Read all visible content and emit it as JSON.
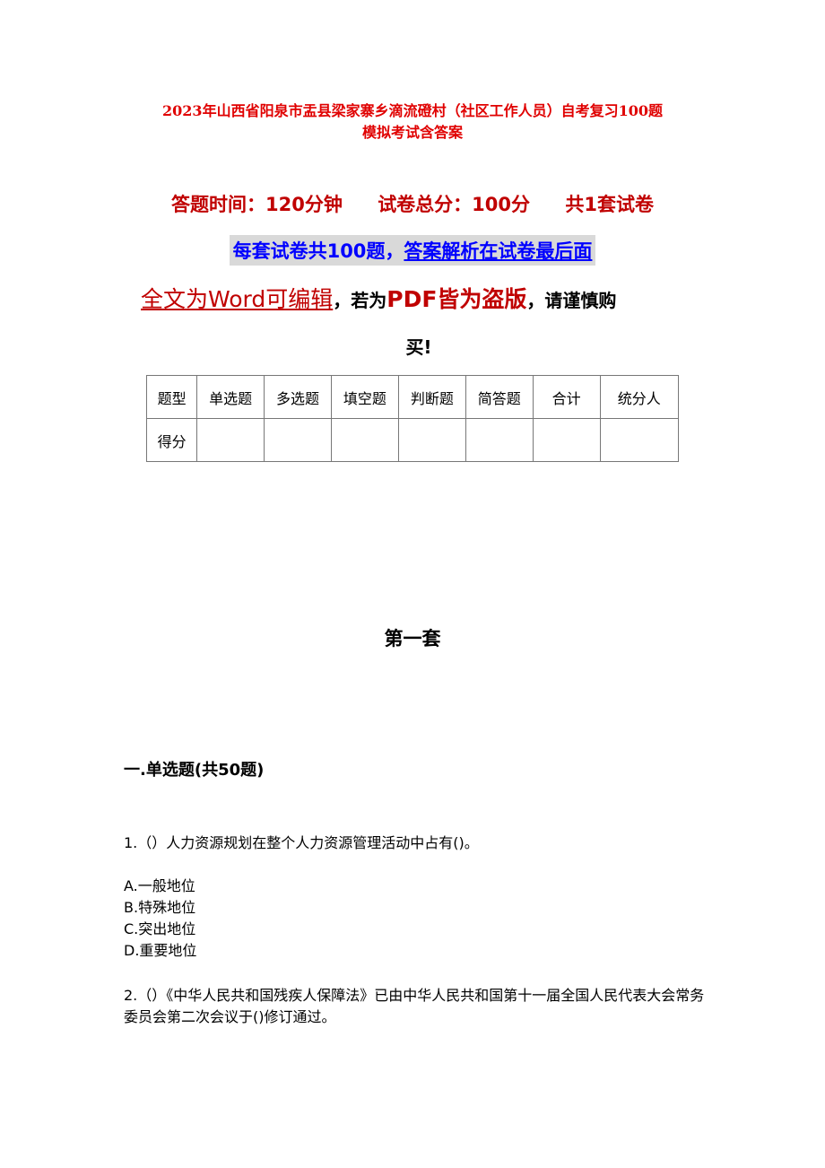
{
  "doc": {
    "title_line1": "2023年山西省阳泉市盂县梁家寨乡滴流磴村（社区工作人员）自考复习100题",
    "title_line2": "模拟考试含答案",
    "info": {
      "time": "答题时间：120分钟",
      "total": "试卷总分：100分",
      "sets": "共1套试卷"
    },
    "notice_blue_a": "每套试卷共100题，",
    "notice_blue_b": "答案解析在试卷最后面",
    "warn_a": "全文为Word可编辑",
    "warn_b": "，若为",
    "warn_c": "PDF皆为盗版",
    "warn_d": "，请谨慎购",
    "warn_e": "买!",
    "score_table": {
      "header": [
        "题型",
        "单选题",
        "多选题",
        "填空题",
        "判断题",
        "简答题",
        "合计",
        "统分人"
      ],
      "row": [
        "得分",
        "",
        "",
        "",
        "",
        "",
        "",
        ""
      ]
    },
    "section_heading": "第一套",
    "part_heading": "一.单选题(共50题)",
    "questions": [
      {
        "text": "1.（）人力资源规划在整个人力资源管理活动中占有()。",
        "options": [
          "A.一般地位",
          "B.特殊地位",
          "C.突出地位",
          "D.重要地位"
        ]
      },
      {
        "text": "2.（）《中华人民共和国残疾人保障法》已由中华人民共和国第十一届全国人民代表大会常务委员会第二次会议于()修订通过。"
      }
    ]
  }
}
